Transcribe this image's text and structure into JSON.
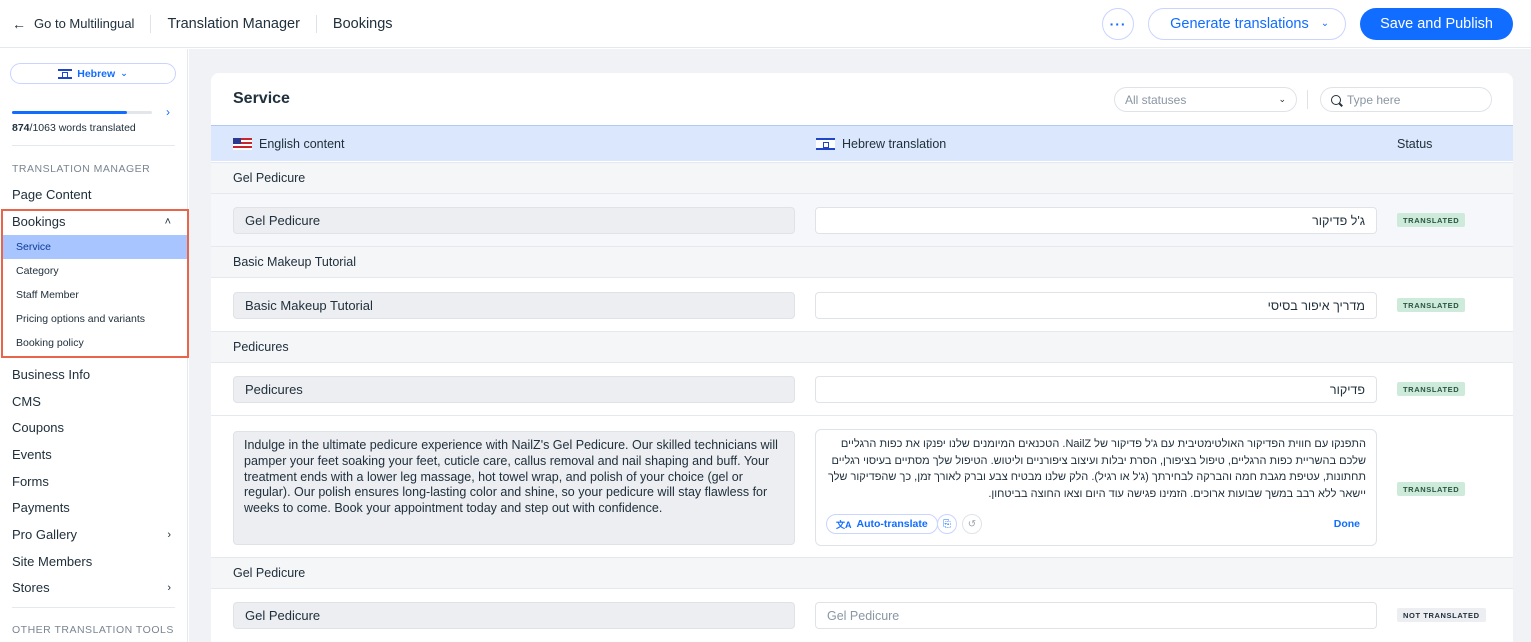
{
  "topbar": {
    "back_label": "Go to Multilingual",
    "crumb1": "Translation Manager",
    "crumb2": "Bookings",
    "more_label": "···",
    "generate_label": "Generate translations",
    "save_label": "Save and Publish"
  },
  "sidebar": {
    "language": "Hebrew",
    "progress_fraction": 0.822,
    "words_translated": "874",
    "words_total": "/1063 words translated",
    "section1_title": "TRANSLATION MANAGER",
    "page_content": "Page Content",
    "bookings": "Bookings",
    "bookings_sub": [
      "Service",
      "Category",
      "Staff Member",
      "Pricing options and variants",
      "Booking policy"
    ],
    "items": [
      "Business Info",
      "CMS",
      "Coupons",
      "Events",
      "Forms",
      "Payments",
      "Pro Gallery",
      "Site Members",
      "Stores"
    ],
    "section2_title": "OTHER TRANSLATION TOOLS"
  },
  "main": {
    "title": "Service",
    "status_filter": "All statuses",
    "search_placeholder": "Type here",
    "col_english": "English content",
    "col_hebrew": "Hebrew translation",
    "col_status": "Status",
    "groups": [
      {
        "header": "Gel Pedicure",
        "source": "Gel Pedicure",
        "translation": "ג'ל פדיקור",
        "status": "TRANSLATED"
      },
      {
        "header": "Basic Makeup Tutorial",
        "source": "Basic Makeup Tutorial",
        "translation": "מדריך איפור בסיסי",
        "status": "TRANSLATED"
      },
      {
        "header": "Pedicures",
        "source": "Pedicures",
        "translation": "פדיקור",
        "status": "TRANSLATED"
      },
      {
        "header": "Gel Pedicure",
        "source": "Gel Pedicure",
        "translation_placeholder": "Gel Pedicure",
        "status": "NOT TRANSLATED"
      }
    ],
    "long_row": {
      "source": "Indulge in the ultimate pedicure experience with NailZ's Gel Pedicure. Our skilled technicians will pamper your feet soaking your feet, cuticle care, callus removal and nail shaping and buff. Your treatment ends with a lower leg massage, hot towel wrap, and polish of your choice (gel or regular). Our polish ensures long-lasting color and shine, so your pedicure will stay flawless for weeks to come. Book your appointment today and step out with confidence.",
      "translation": "התפנקו עם חווית הפדיקור האולטימטיבית עם ג'ל פדיקור של NailZ. הטכנאים המיומנים שלנו יפנקו את כפות הרגליים שלכם בהשריית כפות הרגליים, טיפול בציפורן, הסרת יבלות ועיצוב ציפורניים וליטוש. הטיפול שלך מסתיים בעיסוי רגליים תחתונות, עטיפת מגבת חמה והברקה לבחירתך (ג'ל או רגיל). הלק שלנו מבטיח צבע וברק לאורך זמן, כך שהפדיקור שלך יישאר ללא רבב במשך שבועות ארוכים. הזמינו פגישה עוד היום וצאו החוצה בביטחון.",
      "auto_translate": "Auto-translate",
      "done": "Done",
      "status": "TRANSLATED"
    }
  }
}
